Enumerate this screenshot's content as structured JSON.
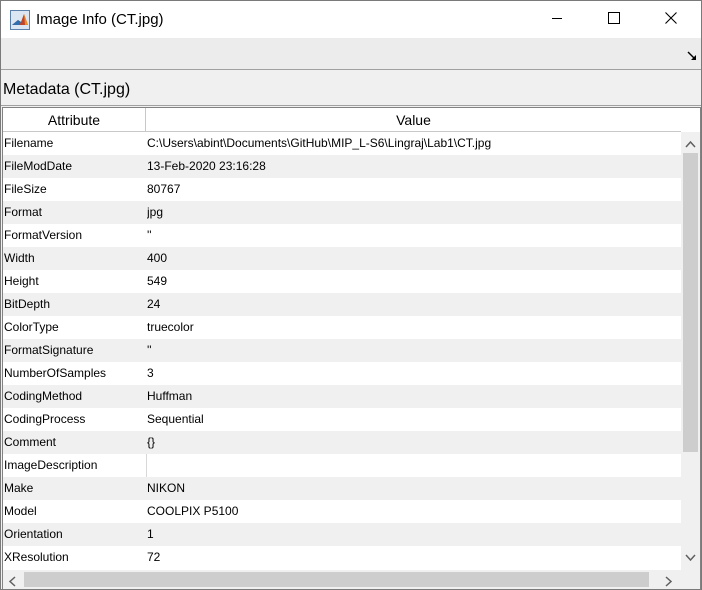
{
  "window": {
    "title": "Image Info (CT.jpg)",
    "icon": "matlab-icon",
    "controls": [
      "minimize-icon",
      "maximize-icon",
      "close-icon"
    ]
  },
  "panel": {
    "title": "Metadata (CT.jpg)"
  },
  "table": {
    "headers": {
      "attribute": "Attribute",
      "value": "Value"
    },
    "rows": [
      {
        "attribute": "Filename",
        "value": "C:\\Users\\abint\\Documents\\GitHub\\MIP_L-S6\\Lingraj\\Lab1\\CT.jpg"
      },
      {
        "attribute": "FileModDate",
        "value": "13-Feb-2020 23:16:28"
      },
      {
        "attribute": "FileSize",
        "value": "80767"
      },
      {
        "attribute": "Format",
        "value": "jpg"
      },
      {
        "attribute": "FormatVersion",
        "value": "''"
      },
      {
        "attribute": "Width",
        "value": "400"
      },
      {
        "attribute": "Height",
        "value": "549"
      },
      {
        "attribute": "BitDepth",
        "value": "24"
      },
      {
        "attribute": "ColorType",
        "value": "truecolor"
      },
      {
        "attribute": "FormatSignature",
        "value": "''"
      },
      {
        "attribute": "NumberOfSamples",
        "value": "3"
      },
      {
        "attribute": "CodingMethod",
        "value": "Huffman"
      },
      {
        "attribute": "CodingProcess",
        "value": "Sequential"
      },
      {
        "attribute": "Comment",
        "value": "{}"
      },
      {
        "attribute": "ImageDescription",
        "value": ""
      },
      {
        "attribute": "Make",
        "value": "NIKON"
      },
      {
        "attribute": "Model",
        "value": "COOLPIX P5100"
      },
      {
        "attribute": "Orientation",
        "value": "1"
      },
      {
        "attribute": "XResolution",
        "value": "72"
      }
    ]
  }
}
